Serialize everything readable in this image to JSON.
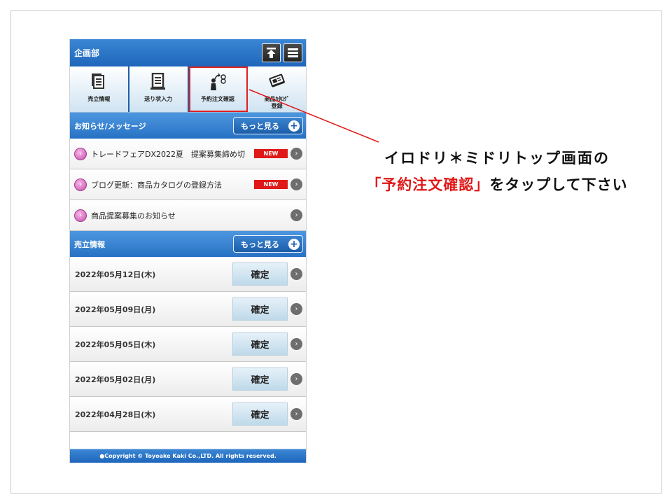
{
  "header": {
    "title": "企画部",
    "top_icon": "arrow-up-to-top-icon",
    "menu_icon": "hamburger-menu-icon"
  },
  "menu": [
    {
      "label": "売立情報",
      "icon": "documents-stack-icon"
    },
    {
      "label": "送り状入力",
      "icon": "document-lines-icon"
    },
    {
      "label": "予約注文確認",
      "icon": "person-sprout-icon"
    },
    {
      "label": "商品ｶﾀﾛｸﾞ\n登録",
      "icon": "catalog-book-icon"
    }
  ],
  "news": {
    "title": "お知らせ/メッセージ",
    "more_label": "もっと見る",
    "items": [
      {
        "text": "トレードフェアDX2022夏　提案募集締め切",
        "badge": "NEW"
      },
      {
        "text": "ブログ更新：商品カタログの登録方法",
        "badge": "NEW"
      },
      {
        "text": "商品提案募集のお知らせ",
        "badge": ""
      }
    ]
  },
  "sales": {
    "title": "売立情報",
    "more_label": "もっと見る",
    "items": [
      {
        "date": "2022年05月12日(木)",
        "action": "確定"
      },
      {
        "date": "2022年05月09日(月)",
        "action": "確定"
      },
      {
        "date": "2022年05月05日(木)",
        "action": "確定"
      },
      {
        "date": "2022年05月02日(月)",
        "action": "確定"
      },
      {
        "date": "2022年04月28日(木)",
        "action": "確定"
      }
    ]
  },
  "footer": {
    "text": "●Copyright © Toyoake Kaki Co.,LTD. All rights reserved."
  },
  "callout": {
    "line1": "イロドリ＊ミドリトップ画面の",
    "line2_highlight": "「予約注文確認」",
    "line2_rest": "をタップして下さい"
  },
  "colors": {
    "header_blue": "#1e66bb",
    "highlight_red": "#e01818",
    "new_badge": "#e01818"
  }
}
